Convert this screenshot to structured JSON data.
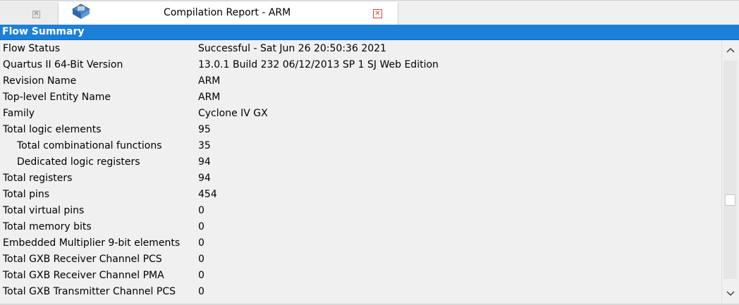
{
  "tabs": [
    {
      "label": "",
      "active": false
    },
    {
      "label": "Compilation Report - ARM",
      "active": true
    }
  ],
  "header": {
    "title": "Flow Summary"
  },
  "rows": [
    {
      "label": "Flow Status",
      "value": "Successful - Sat Jun 26 20:50:36 2021",
      "indent": false
    },
    {
      "label": "Quartus II 64-Bit Version",
      "value": "13.0.1 Build 232 06/12/2013 SP 1 SJ Web Edition",
      "indent": false
    },
    {
      "label": "Revision Name",
      "value": "ARM",
      "indent": false
    },
    {
      "label": "Top-level Entity Name",
      "value": "ARM",
      "indent": false
    },
    {
      "label": "Family",
      "value": "Cyclone IV GX",
      "indent": false
    },
    {
      "label": "Total logic elements",
      "value": "95",
      "indent": false
    },
    {
      "label": "Total combinational functions",
      "value": "35",
      "indent": true
    },
    {
      "label": "Dedicated logic registers",
      "value": "94",
      "indent": true
    },
    {
      "label": "Total registers",
      "value": "94",
      "indent": false
    },
    {
      "label": "Total pins",
      "value": "454",
      "indent": false
    },
    {
      "label": "Total virtual pins",
      "value": "0",
      "indent": false
    },
    {
      "label": "Total memory bits",
      "value": "0",
      "indent": false
    },
    {
      "label": "Embedded Multiplier 9-bit elements",
      "value": "0",
      "indent": false
    },
    {
      "label": "Total GXB Receiver Channel PCS",
      "value": "0",
      "indent": false
    },
    {
      "label": "Total GXB Receiver Channel PMA",
      "value": "0",
      "indent": false
    },
    {
      "label": "Total GXB Transmitter Channel PCS",
      "value": "0",
      "indent": false
    }
  ],
  "icons": {
    "inactive_tab_close": "close-icon",
    "active_tab_close": "close-icon",
    "tab_icon": "report-icon",
    "scroll_up": "chevron-up-icon",
    "scroll_down": "chevron-down-icon"
  },
  "colors": {
    "header_bg": "#1c7fd8",
    "header_text": "#ffffff",
    "close_red": "#d24a3a"
  }
}
